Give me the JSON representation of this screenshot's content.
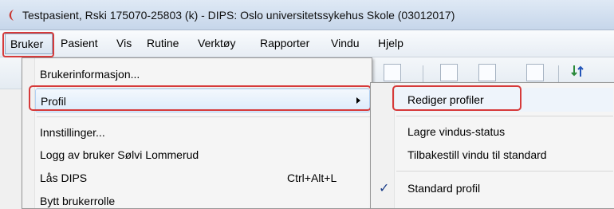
{
  "window": {
    "title": "Testpasient, Rski  175070-25803 (k) - DIPS: Oslo universitetssykehus Skole (03012017)"
  },
  "menubar": {
    "items": [
      "Bruker",
      "Pasient",
      "Vis",
      "Rutine",
      "Verktøy",
      "Rapporter",
      "Vindu",
      "Hjelp"
    ]
  },
  "bruker_menu": {
    "items": [
      {
        "label": "Brukerinformasjon..."
      },
      {
        "label": "Profil",
        "has_submenu": true
      },
      {
        "label": "Innstillinger..."
      },
      {
        "label": "Logg av bruker Sølvi Lommerud"
      },
      {
        "label": "Lås DIPS",
        "shortcut": "Ctrl+Alt+L"
      },
      {
        "label": "Bytt brukerrolle"
      }
    ]
  },
  "profil_submenu": {
    "items": [
      {
        "label": "Rediger profiler"
      },
      {
        "label": "Lagre vindus-status"
      },
      {
        "label": "Tilbakestill vindu til standard"
      },
      {
        "label": "Standard profil",
        "checked": true
      }
    ]
  },
  "colors": {
    "highlight_box": "#d63a3a",
    "app_icon": "#c8352e",
    "checkmark": "#1d3f8a"
  },
  "icons": {
    "app": "dips-app-icon",
    "submenu_arrow": "chevron-right-icon",
    "check": "checkmark-icon"
  }
}
